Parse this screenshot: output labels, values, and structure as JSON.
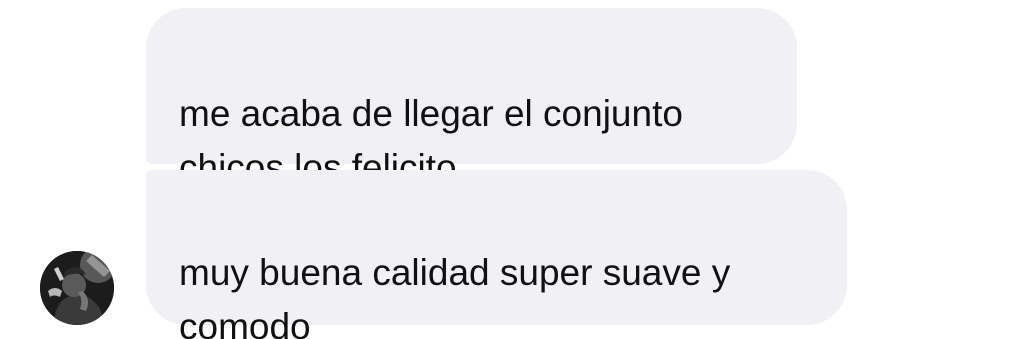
{
  "messages": [
    {
      "sender": "received",
      "text": "me acaba de llegar el conjunto\nchicos los felicito"
    },
    {
      "sender": "received",
      "text": "muy buena calidad super suave y\ncomodo"
    }
  ],
  "avatar": {
    "icon": "user-avatar-photo",
    "style": "black-and-white"
  },
  "colors": {
    "bubble_background": "#f0f0f5",
    "text": "#111111",
    "page_background": "#ffffff"
  }
}
